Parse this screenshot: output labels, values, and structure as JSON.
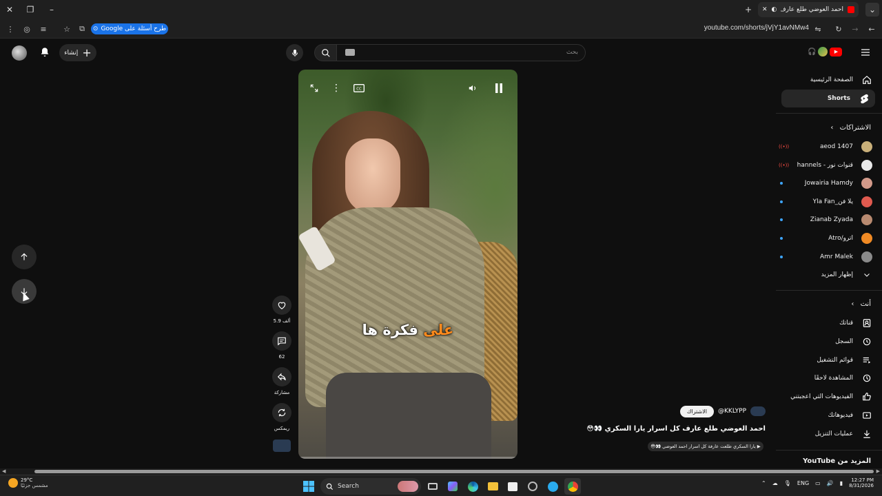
{
  "browser": {
    "tab_title": "احمد العوضي طلع عارف كل",
    "url": "youtube.com/shorts/jVjY1avNMw4",
    "google_chip": "طرح أسئلة على Google"
  },
  "header": {
    "create_label": "إنشاء",
    "search_placeholder": "بحث"
  },
  "sidebar": {
    "home": "الصفحة الرئيسية",
    "shorts": "Shorts",
    "subscriptions_title": "الاشتراكات",
    "channels": [
      {
        "name": "aeod 1407",
        "status": "live",
        "color": "#c9b07a"
      },
      {
        "name": "قنوات نور - hannels...",
        "status": "live",
        "color": "#e8e8e8"
      },
      {
        "name": "Jowairia Hamdy",
        "status": "new",
        "color": "#d39a8a"
      },
      {
        "name": "يلا فن_Yla Fan",
        "status": "new",
        "color": "#e05a4f"
      },
      {
        "name": "Zianab Zyada",
        "status": "new",
        "color": "#b88a70"
      },
      {
        "name": "أترو/Atro",
        "status": "new",
        "color": "#f08a24"
      },
      {
        "name": "Amr Malek",
        "status": "new",
        "color": "#8a8a8a"
      }
    ],
    "live_label": "((•))",
    "show_more": "إظهار المزيد",
    "you_title": "أنت",
    "you_items": [
      "قناتك",
      "السجل",
      "قوائم التشغيل",
      "المشاهدة لاحقًا",
      "الفيديوهات التي أعجبتني",
      "فيديوهاتك",
      "عمليات التنزيل"
    ],
    "more_from": "المزيد من YouTube"
  },
  "video": {
    "caption_highlight": "على",
    "caption_rest": "فكرة ها",
    "channel": "@KKLYPP",
    "subscribe": "الاشتراك",
    "title": "احمد العوضي طلع عارف كل اسرار يارا السكري 👀😳",
    "related": "▶ يارا السكري طلعت عارفة كل اسرار احمد العوضي 👀😳",
    "progress": 0.0
  },
  "actions": {
    "likes": "5.9 ألف",
    "comments": "62",
    "share": "مشاركة",
    "remix": "ريمكس"
  },
  "taskbar": {
    "weather_temp": "29°C",
    "weather_desc": "مشمس جزئيًا",
    "search": "Search",
    "lang": "ENG",
    "time": "12:27 PM",
    "date": "8/31/2026"
  }
}
